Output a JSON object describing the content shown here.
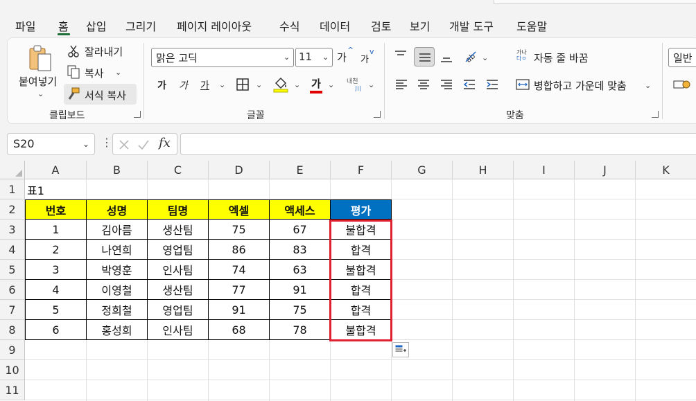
{
  "ribbon_tabs": [
    "파일",
    "홈",
    "삽입",
    "그리기",
    "페이지 레이아웃",
    "수식",
    "데이터",
    "검토",
    "보기",
    "개발 도구",
    "도움말"
  ],
  "active_tab": "홈",
  "clipboard": {
    "paste": "붙여넣기",
    "cut": "잘라내기",
    "copy": "복사",
    "format_painter": "서식 복사",
    "group_label": "클립보드"
  },
  "font": {
    "name": "맑은 고딕",
    "size": "11",
    "grow": "가",
    "shrink": "가",
    "bold": "가",
    "italic": "가",
    "underline": "가",
    "font_color_letter": "가",
    "phonetic_top": "내천",
    "phonetic_bottom": "川",
    "group_label": "글꼴"
  },
  "alignment": {
    "wrap_text_icon_top": "가나",
    "wrap_text_icon_bottom": "다ㅇ",
    "wrap_text": "자동 줄 바꿈",
    "merge_center": "병합하고 가운데 맞춤",
    "group_label": "맞춤"
  },
  "number": {
    "format": "일반"
  },
  "formula_bar": {
    "name_box": "S20",
    "fx": "fx",
    "value": ""
  },
  "sheet": {
    "columns": [
      "A",
      "B",
      "C",
      "D",
      "E",
      "F",
      "G",
      "H",
      "I",
      "J",
      "K"
    ],
    "rows": [
      "1",
      "2",
      "3",
      "4",
      "5",
      "6",
      "7",
      "8",
      "9",
      "10",
      "11"
    ],
    "title": "표1",
    "headers": [
      "번호",
      "성명",
      "팀명",
      "엑셀",
      "액세스",
      "평가"
    ],
    "data": [
      [
        "1",
        "김아름",
        "생산팀",
        "75",
        "67",
        "불합격"
      ],
      [
        "2",
        "나연희",
        "영업팀",
        "86",
        "83",
        "합격"
      ],
      [
        "3",
        "박영훈",
        "인사팀",
        "74",
        "63",
        "불합격"
      ],
      [
        "4",
        "이영철",
        "생산팀",
        "77",
        "91",
        "합격"
      ],
      [
        "5",
        "정희철",
        "영업팀",
        "91",
        "75",
        "합격"
      ],
      [
        "6",
        "홍성희",
        "인사팀",
        "68",
        "78",
        "불합격"
      ]
    ],
    "colors": {
      "header_yellow": "#ffff00",
      "header_blue": "#0070c0",
      "highlight_red": "#e02030"
    }
  }
}
